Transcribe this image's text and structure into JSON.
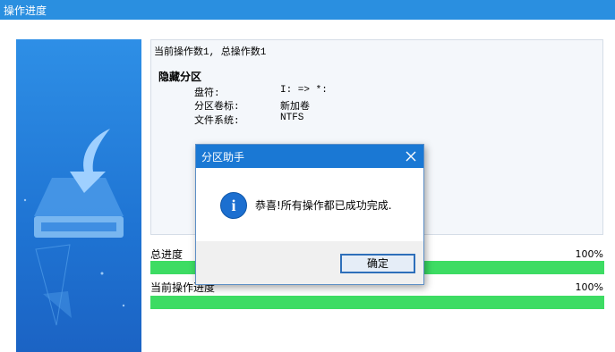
{
  "window": {
    "title": "操作进度"
  },
  "log": {
    "summary": "当前操作数1, 总操作数1",
    "section_title": "隐藏分区",
    "rows": [
      {
        "label": "盘符:",
        "value": "I: => *:"
      },
      {
        "label": "分区卷标:",
        "value": "新加卷"
      },
      {
        "label": "文件系统:",
        "value": "NTFS"
      }
    ]
  },
  "progress": {
    "total": {
      "label": "总进度",
      "percent_text": "100%",
      "fraction": 1.0
    },
    "current": {
      "label": "当前操作进度",
      "percent_text": "100%",
      "fraction": 1.0
    }
  },
  "dialog": {
    "title": "分区助手",
    "message": "恭喜!所有操作都已成功完成.",
    "icon": "info-icon",
    "ok_label": "确定"
  },
  "colors": {
    "titlebar": "#2a8fe0",
    "dialog_title": "#1a78d4",
    "progress_fill": "#3ddc63"
  }
}
